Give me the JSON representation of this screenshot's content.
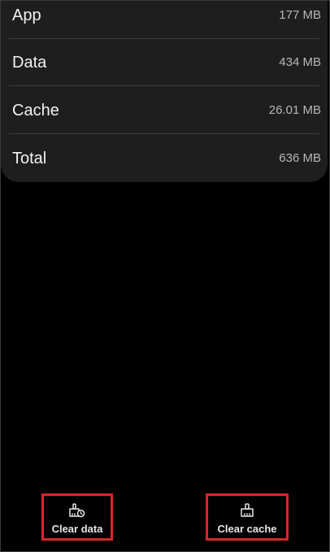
{
  "storage": {
    "rows": [
      {
        "label": "App",
        "value": "177 MB"
      },
      {
        "label": "Data",
        "value": "434 MB"
      },
      {
        "label": "Cache",
        "value": "26.01 MB"
      },
      {
        "label": "Total",
        "value": "636 MB"
      }
    ]
  },
  "actions": {
    "clear_data": {
      "label": "Clear data",
      "icon": "clear-data-icon"
    },
    "clear_cache": {
      "label": "Clear cache",
      "icon": "clear-cache-icon"
    }
  },
  "colors": {
    "background": "#000000",
    "card": "#1e1e1e",
    "highlight_box": "#d9262a"
  }
}
